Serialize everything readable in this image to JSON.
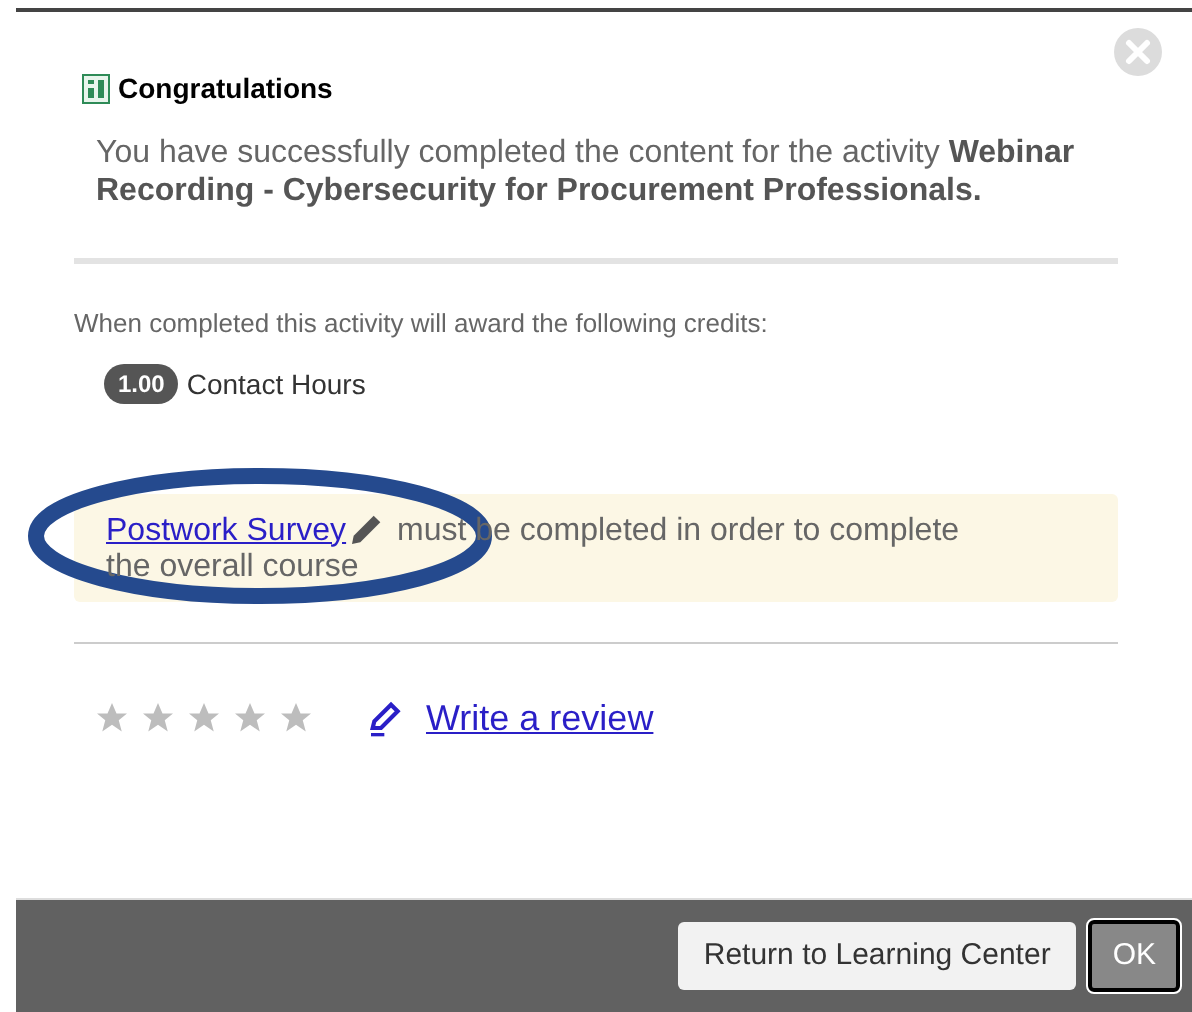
{
  "dialog": {
    "title": "Congratulations",
    "message": "You have successfully completed the content for the activity **Webinar Recording - Cybersecurity for Procurement Professionals.**"
  },
  "credits": {
    "intro": "When completed this activity will award the following credits:",
    "items": [
      {
        "amount": "1.00",
        "label": "Contact Hours"
      }
    ]
  },
  "notice": {
    "link": "Postwork Survey",
    "text": "must be completed in order to complete the overall course"
  },
  "review": {
    "stars": 0,
    "link": "Write a review"
  },
  "buttons": [
    {
      "label": "Return to Learning Center",
      "kind": "secondary"
    },
    {
      "label": "OK",
      "kind": "primary"
    }
  ]
}
